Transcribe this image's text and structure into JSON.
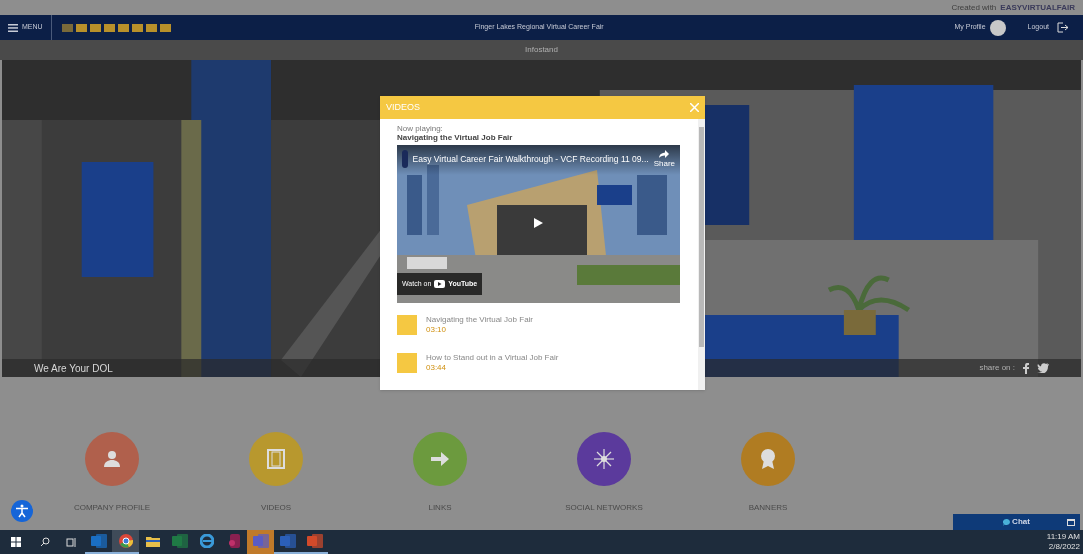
{
  "top_bar": {
    "credit": "Created with",
    "brand": "EASYVIRTUALFAIR"
  },
  "nav": {
    "menu": "MENU",
    "languages": [
      {
        "color": "#7a6a3a"
      },
      {
        "color": "#b8902a"
      },
      {
        "color": "#b8902a"
      },
      {
        "color": "#b8902a"
      },
      {
        "color": "#b8902a"
      },
      {
        "color": "#b8902a"
      },
      {
        "color": "#b8902a"
      },
      {
        "color": "#b8902a"
      }
    ],
    "title": "Finger Lakes Regional Virtual Career Fair",
    "profile": "My Profile",
    "logout": "Logout"
  },
  "breadcrumb": "Infostand",
  "scene": {
    "kind": "picture",
    "caption": "We Are Your DOL",
    "share_label": "share on :"
  },
  "modal": {
    "title": "VIDEOS",
    "now_playing_label": "Now playing:",
    "now_playing": "Navigating the Virtual Job Fair",
    "player": {
      "title": "Easy Virtual Career Fair Walkthrough - VCF Recording 11 09...",
      "share": "Share",
      "watch_on": "Watch on",
      "platform": "YouTube"
    },
    "videos": [
      {
        "title": "Navigating the Virtual Job Fair",
        "duration": "03:10"
      },
      {
        "title": "How to Stand out in a Virtual Job Fair",
        "duration": "03:44"
      }
    ]
  },
  "tiles": [
    {
      "label": "COMPANY PROFILE",
      "kind": "person",
      "color": "#b0604c"
    },
    {
      "label": "VIDEOS",
      "kind": "film",
      "color": "#b8982e"
    },
    {
      "label": "LINKS",
      "kind": "arrow",
      "color": "#6c9a3e"
    },
    {
      "label": "SOCIAL NETWORKS",
      "kind": "network",
      "color": "#5b3a9c"
    },
    {
      "label": "BANNERS",
      "kind": "ribbon",
      "color": "#b07c22"
    }
  ],
  "chat": {
    "label": "Chat"
  },
  "taskbar": {
    "apps": [
      {
        "kind": "outlook",
        "running": true,
        "selected": false
      },
      {
        "kind": "chrome",
        "running": true,
        "selected": true
      },
      {
        "kind": "explorer",
        "running": false,
        "selected": false
      },
      {
        "kind": "excel",
        "running": false,
        "selected": false
      },
      {
        "kind": "edge",
        "running": false,
        "selected": false
      },
      {
        "kind": "app",
        "running": false,
        "selected": false
      },
      {
        "kind": "teams",
        "running": false,
        "selected": false,
        "flashing": true
      },
      {
        "kind": "word",
        "running": true,
        "selected": false
      },
      {
        "kind": "powerpoint",
        "running": true,
        "selected": false
      }
    ],
    "time": "11:19 AM",
    "date": "2/8/2022"
  }
}
